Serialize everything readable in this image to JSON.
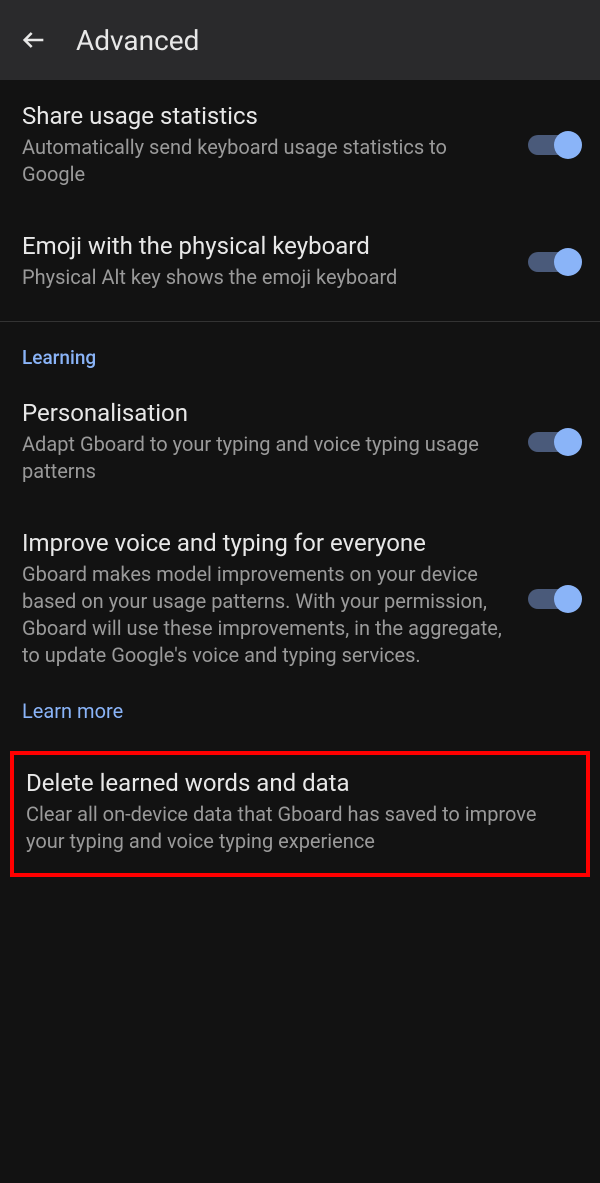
{
  "header": {
    "title": "Advanced"
  },
  "settings": {
    "share_stats": {
      "title": "Share usage statistics",
      "desc": "Automatically send keyboard usage statistics to Google"
    },
    "emoji_physical": {
      "title": "Emoji with the physical keyboard",
      "desc": "Physical Alt key shows the emoji keyboard"
    }
  },
  "section": {
    "learning": "Learning"
  },
  "learning": {
    "personalisation": {
      "title": "Personalisation",
      "desc": "Adapt Gboard to your typing and voice typing usage patterns"
    },
    "improve": {
      "title": "Improve voice and typing for everyone",
      "desc": "Gboard makes model improvements on your device based on your usage patterns. With your permission, Gboard will use these improvements, in the aggregate, to update Google's voice and typing services."
    },
    "learn_more": "Learn more",
    "delete": {
      "title": "Delete learned words and data",
      "desc": "Clear all on-device data that Gboard has saved to improve your typing and voice typing experience"
    }
  }
}
